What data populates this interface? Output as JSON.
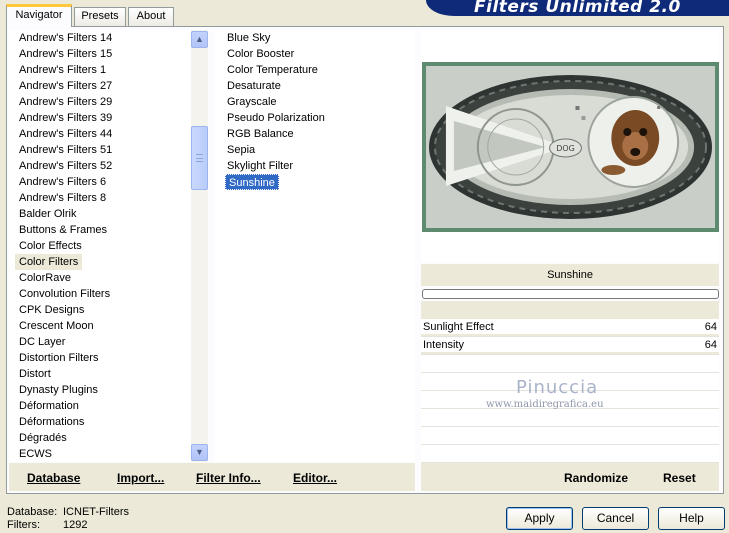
{
  "banner": {
    "title": "Filters Unlimited 2.0"
  },
  "tabs": [
    {
      "label": "Navigator",
      "active": true
    },
    {
      "label": "Presets",
      "active": false
    },
    {
      "label": "About",
      "active": false
    }
  ],
  "categories": {
    "items": [
      "Andrew's Filters 14",
      "Andrew's Filters 15",
      "Andrew's Filters 1",
      "Andrew's Filters 27",
      "Andrew's Filters 29",
      "Andrew's Filters 39",
      "Andrew's Filters 44",
      "Andrew's Filters 51",
      "Andrew's Filters 52",
      "Andrew's Filters 6",
      "Andrew's Filters 8",
      "Balder Olrik",
      "Buttons & Frames",
      "Color Effects",
      "Color Filters",
      "ColorRave",
      "Convolution Filters",
      "CPK Designs",
      "Crescent Moon",
      "DC Layer",
      "Distortion Filters",
      "Distort",
      "Dynasty Plugins",
      "Déformation",
      "Déformations",
      "Dégradés",
      "ECWS"
    ],
    "selected": "Color Filters"
  },
  "filters": {
    "items": [
      "Blue Sky",
      "Color Booster",
      "Color Temperature",
      "Desaturate",
      "Grayscale",
      "Pseudo Polarization",
      "RGB Balance",
      "Sepia",
      "Skylight Filter",
      "Sunshine"
    ],
    "selected": "Sunshine"
  },
  "preview": {
    "dog_text": "DOG",
    "accent": "#5e8a70"
  },
  "filter_name": "Sunshine",
  "parameters": [
    {
      "label": "Sunlight Effect",
      "value": "64"
    },
    {
      "label": "Intensity",
      "value": "64"
    }
  ],
  "watermark": {
    "name": "Pinuccia",
    "url": "www.maidiregrafica.eu"
  },
  "left_buttons": {
    "database": "Database",
    "import": "Import...",
    "filter_info": "Filter Info...",
    "editor": "Editor..."
  },
  "right_buttons": {
    "randomize": "Randomize",
    "reset": "Reset"
  },
  "status": {
    "database_label": "Database:",
    "database_value": "ICNET-Filters",
    "filters_label": "Filters:",
    "filters_value": "1292"
  },
  "dialog_buttons": {
    "apply": "Apply",
    "cancel": "Cancel",
    "help": "Help"
  }
}
